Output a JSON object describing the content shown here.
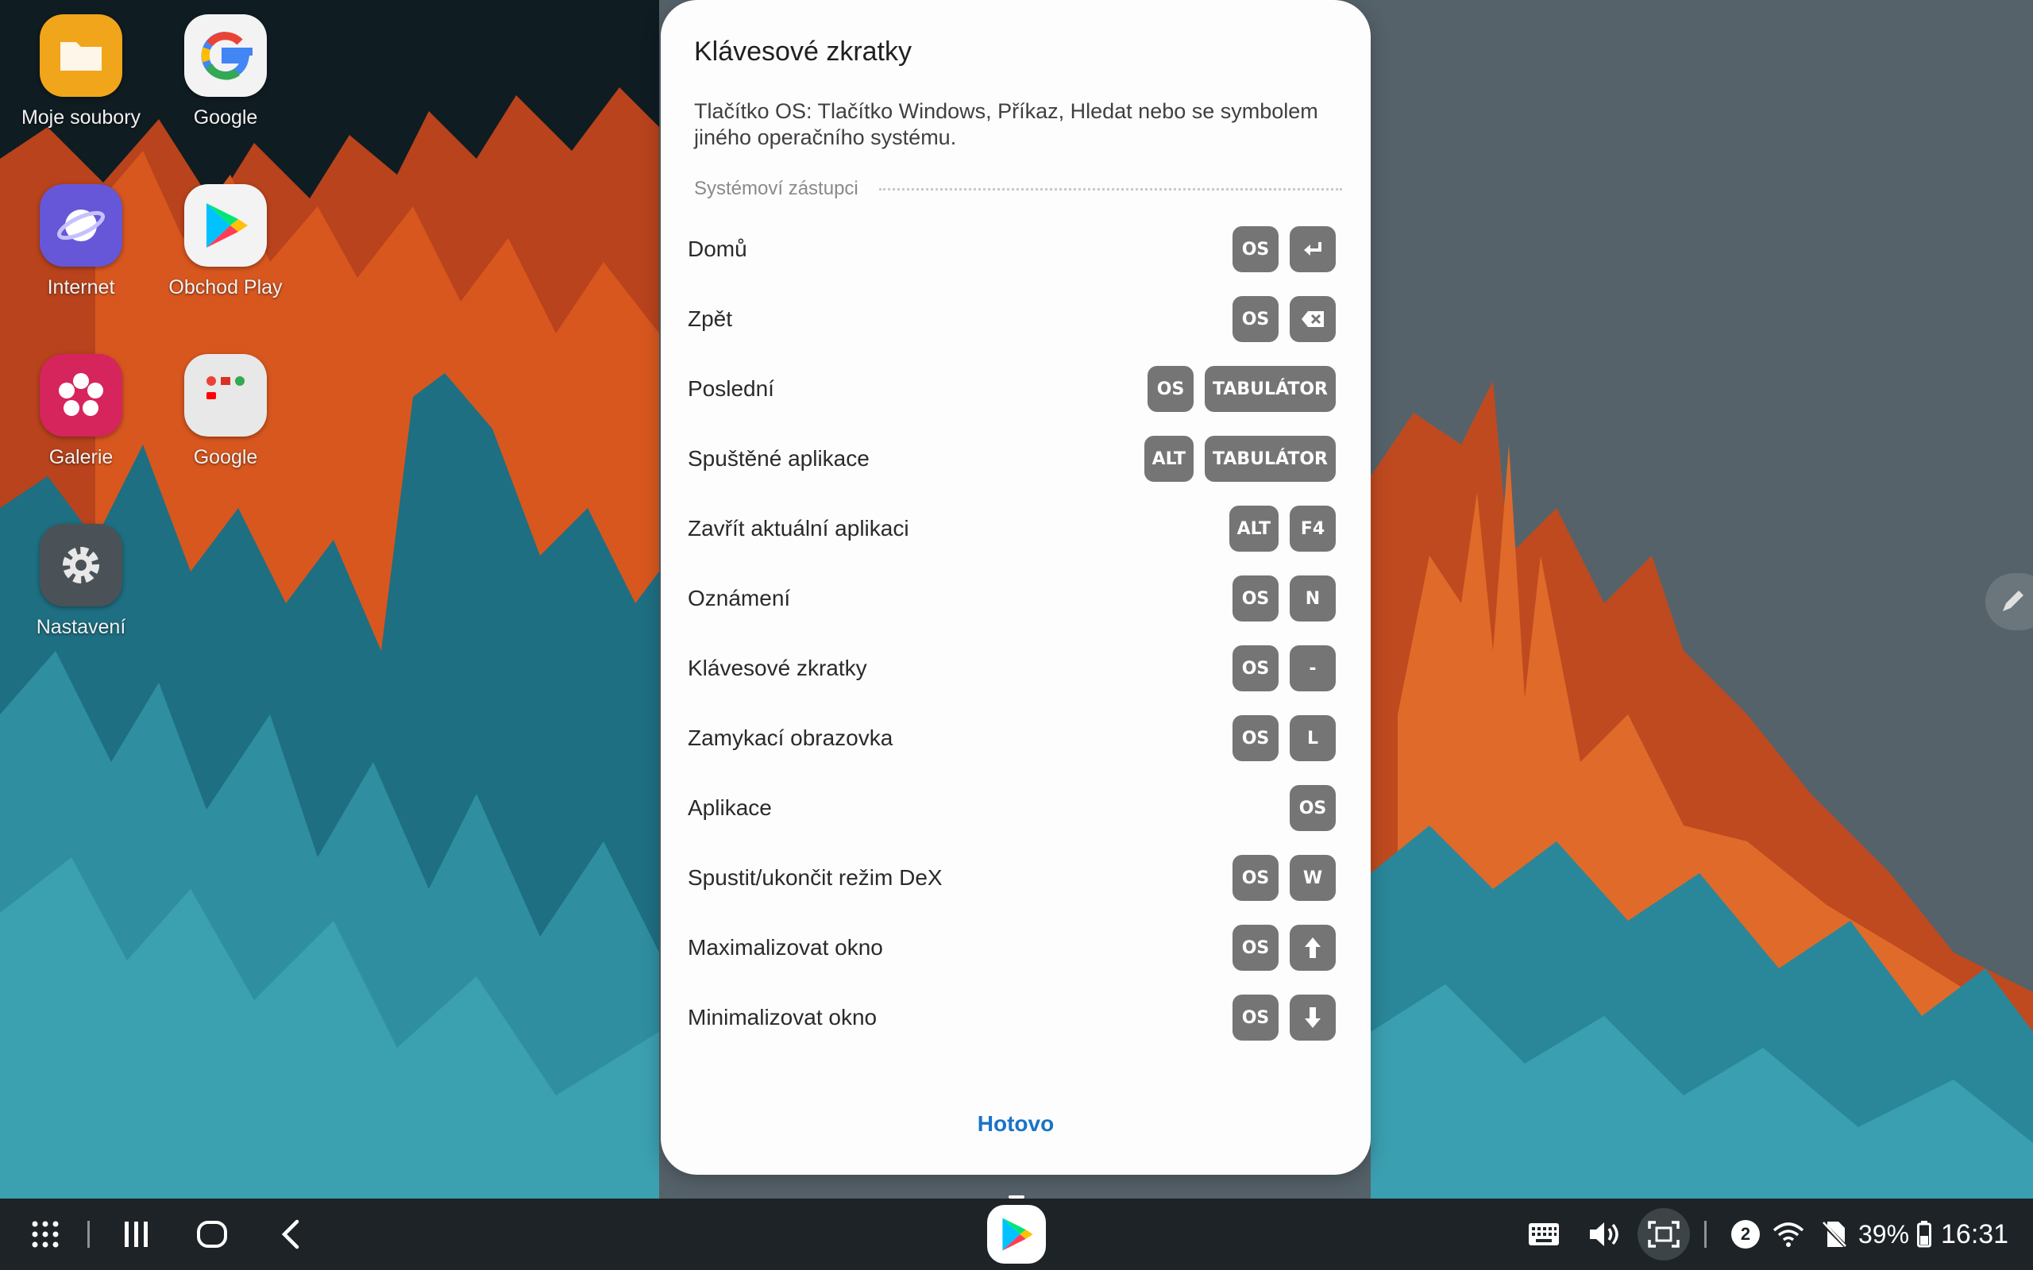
{
  "desktop": {
    "icons": [
      {
        "label": "Moje soubory",
        "icon": "folder-icon"
      },
      {
        "label": "Google",
        "icon": "google-icon"
      },
      {
        "label": "Internet",
        "icon": "samsung-internet-icon"
      },
      {
        "label": "Obchod Play",
        "icon": "play-store-icon"
      },
      {
        "label": "Galerie",
        "icon": "gallery-icon"
      },
      {
        "label": "Google",
        "icon": "google-folder-icon"
      },
      {
        "label": "Nastavení",
        "icon": "settings-gear-icon"
      }
    ]
  },
  "dialog": {
    "title": "Klávesové zkratky",
    "description": "Tlačítko OS: Tlačítko Windows, Příkaz, Hledat nebo se symbolem jiného operačního systému.",
    "section_label": "Systémoví zástupci",
    "done_label": "Hotovo",
    "shortcuts": [
      {
        "label": "Domů",
        "keys": [
          "OS",
          "enter-icon"
        ]
      },
      {
        "label": "Zpět",
        "keys": [
          "OS",
          "backspace-icon"
        ]
      },
      {
        "label": "Poslední",
        "keys": [
          "OS",
          "TABULÁTOR"
        ]
      },
      {
        "label": "Spuštěné aplikace",
        "keys": [
          "ALT",
          "TABULÁTOR"
        ]
      },
      {
        "label": "Zavřít aktuální aplikaci",
        "keys": [
          "ALT",
          "F4"
        ]
      },
      {
        "label": "Oznámení",
        "keys": [
          "OS",
          "N"
        ]
      },
      {
        "label": "Klávesové zkratky",
        "keys": [
          "OS",
          "-"
        ]
      },
      {
        "label": "Zamykací obrazovka",
        "keys": [
          "OS",
          "L"
        ]
      },
      {
        "label": "Aplikace",
        "keys": [
          "OS"
        ]
      },
      {
        "label": "Spustit/ukončit režim DeX",
        "keys": [
          "OS",
          "W"
        ]
      },
      {
        "label": "Maximalizovat okno",
        "keys": [
          "OS",
          "arrow-up-icon"
        ]
      },
      {
        "label": "Minimalizovat okno",
        "keys": [
          "OS",
          "arrow-down-icon"
        ]
      }
    ]
  },
  "taskbar": {
    "notification_count": "2",
    "battery": "39%",
    "time": "16:31"
  },
  "colors": {
    "accent": "#1a73c7",
    "key_bg": "#757575",
    "taskbar_bg": "#1d2327"
  }
}
